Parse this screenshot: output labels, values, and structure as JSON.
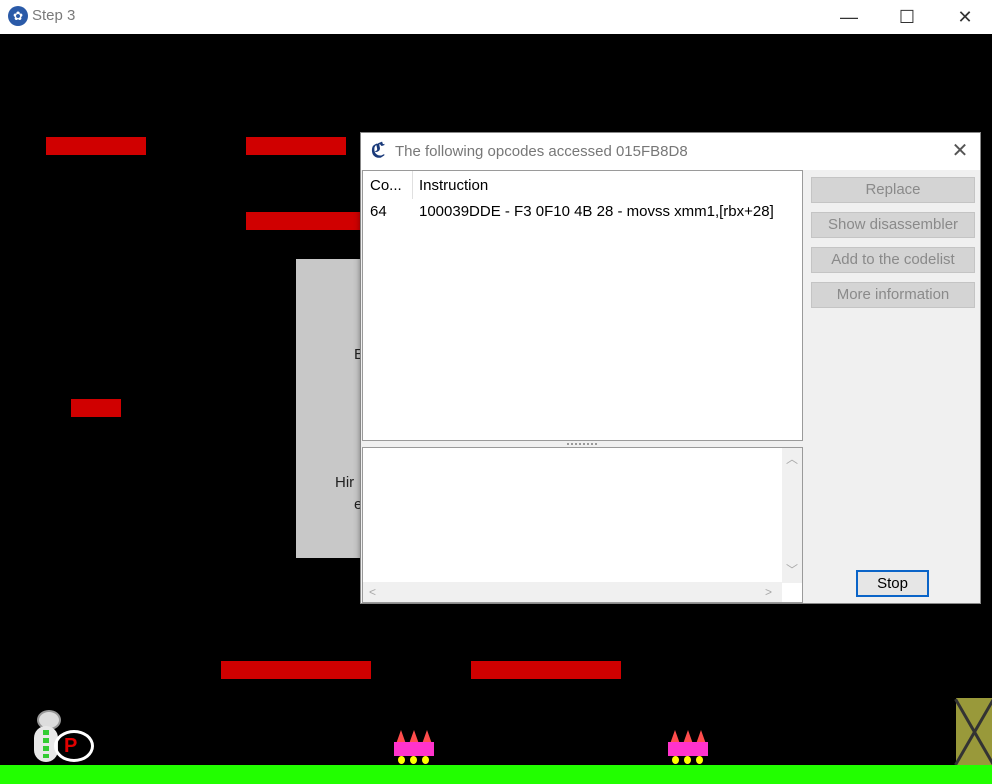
{
  "window": {
    "title": "Step 3"
  },
  "info_panel": {
    "line1": "E",
    "line2": "Hir",
    "line3": "e"
  },
  "dialog": {
    "title": "The following opcodes accessed 015FB8D8",
    "columns": {
      "count": "Co...",
      "instruction": "Instruction"
    },
    "rows": [
      {
        "count": "64",
        "instruction": "100039DDE - F3 0F10 4B 28  - movss xmm1,[rbx+28]"
      }
    ],
    "buttons": {
      "replace": "Replace",
      "show_disassembler": "Show disassembler",
      "add_to_codelist": "Add to the codelist",
      "more_information": "More information",
      "stop": "Stop"
    }
  },
  "player_badge": "P",
  "colors": {
    "platform": "#d00000",
    "ground": "#22ff00",
    "background": "#000000"
  }
}
